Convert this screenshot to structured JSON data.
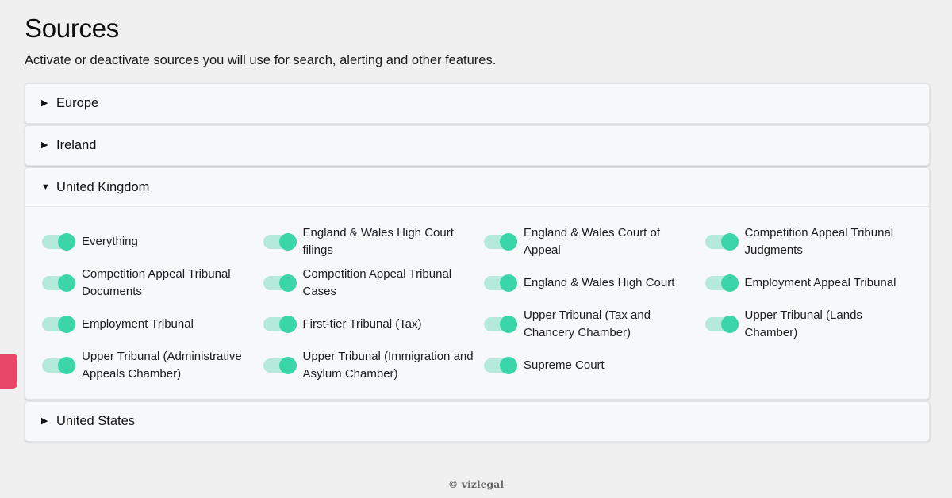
{
  "page": {
    "title": "Sources",
    "subtitle": "Activate or deactivate sources you will use for search, alerting and other features."
  },
  "regions": [
    {
      "label": "Europe",
      "expanded": false
    },
    {
      "label": "Ireland",
      "expanded": false
    },
    {
      "label": "United Kingdom",
      "expanded": true
    },
    {
      "label": "United States",
      "expanded": false
    }
  ],
  "uk_sources": [
    {
      "label": "Everything",
      "enabled": true
    },
    {
      "label": "England & Wales High Court filings",
      "enabled": true
    },
    {
      "label": "England & Wales Court of Appeal",
      "enabled": true
    },
    {
      "label": "Competition Appeal Tribunal Judgments",
      "enabled": true
    },
    {
      "label": "Competition Appeal Tribunal Documents",
      "enabled": true
    },
    {
      "label": "Competition Appeal Tribunal Cases",
      "enabled": true
    },
    {
      "label": "England & Wales High Court",
      "enabled": true
    },
    {
      "label": "Employment Appeal Tribunal",
      "enabled": true
    },
    {
      "label": "Employment Tribunal",
      "enabled": true
    },
    {
      "label": "First-tier Tribunal (Tax)",
      "enabled": true
    },
    {
      "label": "Upper Tribunal (Tax and Chancery Chamber)",
      "enabled": true
    },
    {
      "label": "Upper Tribunal (Lands Chamber)",
      "enabled": true
    },
    {
      "label": "Upper Tribunal (Administrative Appeals Chamber)",
      "enabled": true
    },
    {
      "label": "Upper Tribunal (Immigration and Asylum Chamber)",
      "enabled": true
    },
    {
      "label": "Supreme Court",
      "enabled": true
    }
  ],
  "icons": {
    "collapsed_caret": "triangle-right-icon",
    "expanded_caret": "triangle-down-icon"
  },
  "colors": {
    "toggle_track_on": "#b5eadb",
    "toggle_knob_on": "#3ad6a9",
    "side_tab": "#e8476a",
    "background": "#f0f0f0"
  },
  "footer": {
    "text": "© vizlegal"
  }
}
